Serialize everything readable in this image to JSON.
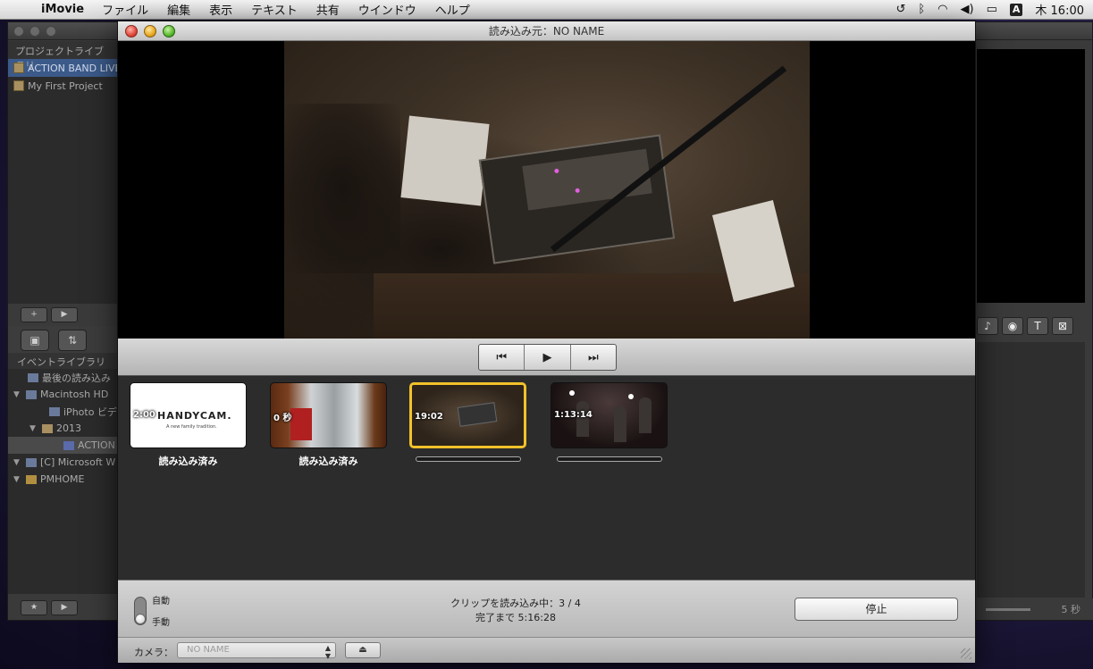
{
  "menubar": {
    "app": "iMovie",
    "items": [
      "ファイル",
      "編集",
      "表示",
      "テキスト",
      "共有",
      "ウインドウ",
      "ヘルプ"
    ],
    "clock": "木 16:00",
    "input_badge": "A",
    "icons": [
      "time-machine-icon",
      "bluetooth-icon",
      "wifi-icon",
      "volume-icon",
      "battery-icon"
    ]
  },
  "background_window": {
    "project_library": {
      "title": "プロジェクトライブラリ",
      "items": [
        "ACTION BAND LIVE",
        "My First Project"
      ]
    },
    "event_library": {
      "title": "イベントライブラリ",
      "items": [
        {
          "label": "最後の読み込み",
          "indent": 1
        },
        {
          "label": "Macintosh HD",
          "indent": 0
        },
        {
          "label": "iPhoto ビデオ",
          "indent": 2
        },
        {
          "label": "2013",
          "indent": 1
        },
        {
          "label": "ACTION",
          "indent": 3
        },
        {
          "label": "[C] Microsoft W",
          "indent": 0
        },
        {
          "label": "PMHOME",
          "indent": 0
        }
      ]
    },
    "zoom_label": "5 秒"
  },
  "import_window": {
    "title": "読み込み元：NO NAME",
    "transport": {
      "prev_icon": "skip-back-icon",
      "play_icon": "play-icon",
      "next_icon": "skip-forward-icon"
    },
    "clips": [
      {
        "duration": "2:00",
        "logo": "HANDYCAM.",
        "tagline": "A new family tradition.",
        "status": "読み込み済み",
        "progress": 1,
        "selected": false
      },
      {
        "duration": "0 秒",
        "status": "読み込み済み",
        "progress": 1,
        "selected": false
      },
      {
        "duration": "19:02",
        "status": "",
        "progress": 0,
        "selected": true
      },
      {
        "duration": "1:13:14",
        "status": "",
        "progress": 0,
        "selected": false
      }
    ],
    "mode": {
      "auto_label": "自動",
      "manual_label": "手動",
      "selected": "manual"
    },
    "status": {
      "line1": "クリップを読み込み中：3 / 4",
      "line2": "完了まで 5:16:28"
    },
    "stop_button": "停止",
    "camera": {
      "label": "カメラ：",
      "selected": "NO NAME"
    }
  }
}
